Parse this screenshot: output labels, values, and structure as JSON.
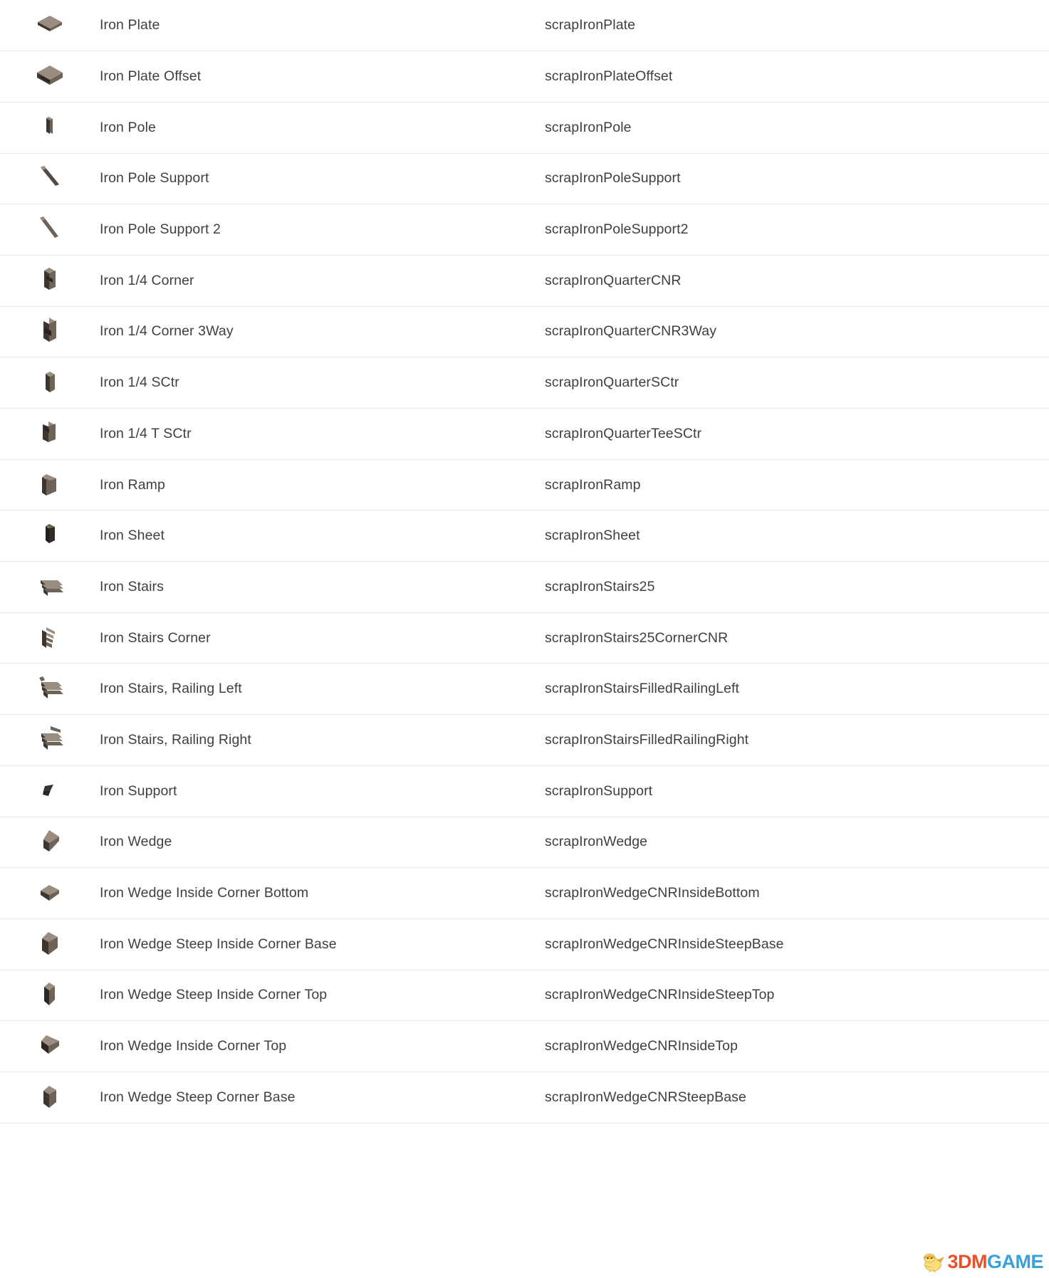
{
  "table": {
    "columns": [
      "icon",
      "display_name",
      "internal_id"
    ],
    "rows": [
      {
        "icon": "iron-plate-icon",
        "name": "Iron Plate",
        "id": "scrapIronPlate",
        "shape": "plate"
      },
      {
        "icon": "iron-plate-offset-icon",
        "name": "Iron Plate Offset",
        "id": "scrapIronPlateOffset",
        "shape": "plate-offset"
      },
      {
        "icon": "iron-pole-icon",
        "name": "Iron Pole",
        "id": "scrapIronPole",
        "shape": "pole"
      },
      {
        "icon": "iron-pole-support-icon",
        "name": "Iron Pole Support",
        "id": "scrapIronPoleSupport",
        "shape": "diag"
      },
      {
        "icon": "iron-pole-support-2-icon",
        "name": "Iron Pole Support 2",
        "id": "scrapIronPoleSupport2",
        "shape": "diag2"
      },
      {
        "icon": "iron-quarter-corner-icon",
        "name": "Iron 1/4 Corner",
        "id": "scrapIronQuarterCNR",
        "shape": "qcorner"
      },
      {
        "icon": "iron-quarter-corner-3way-icon",
        "name": "Iron 1/4 Corner 3Way",
        "id": "scrapIronQuarterCNR3Way",
        "shape": "qcorner3"
      },
      {
        "icon": "iron-quarter-sctr-icon",
        "name": "Iron 1/4 SCtr",
        "id": "scrapIronQuarterSCtr",
        "shape": "qsctr"
      },
      {
        "icon": "iron-quarter-tee-sctr-icon",
        "name": "Iron 1/4 T SCtr",
        "id": "scrapIronQuarterTeeSCtr",
        "shape": "qtee"
      },
      {
        "icon": "iron-ramp-icon",
        "name": "Iron Ramp",
        "id": "scrapIronRamp",
        "shape": "ramp"
      },
      {
        "icon": "iron-sheet-icon",
        "name": "Iron Sheet",
        "id": "scrapIronSheet",
        "shape": "sheet"
      },
      {
        "icon": "iron-stairs-icon",
        "name": "Iron Stairs",
        "id": "scrapIronStairs25",
        "shape": "stairs"
      },
      {
        "icon": "iron-stairs-corner-icon",
        "name": "Iron Stairs Corner",
        "id": "scrapIronStairs25CornerCNR",
        "shape": "stairs-corner"
      },
      {
        "icon": "iron-stairs-railing-left-icon",
        "name": "Iron Stairs, Railing Left",
        "id": "scrapIronStairsFilledRailingLeft",
        "shape": "stairs-rail-l"
      },
      {
        "icon": "iron-stairs-railing-right-icon",
        "name": "Iron Stairs, Railing Right",
        "id": "scrapIronStairsFilledRailingRight",
        "shape": "stairs-rail-r"
      },
      {
        "icon": "iron-support-icon",
        "name": "Iron Support",
        "id": "scrapIronSupport",
        "shape": "support"
      },
      {
        "icon": "iron-wedge-icon",
        "name": "Iron Wedge",
        "id": "scrapIronWedge",
        "shape": "wedge"
      },
      {
        "icon": "iron-wedge-inside-corner-bottom-icon",
        "name": "Iron Wedge Inside Corner Bottom",
        "id": "scrapIronWedgeCNRInsideBottom",
        "shape": "wedge-flat"
      },
      {
        "icon": "iron-wedge-steep-inside-corner-base-icon",
        "name": "Iron Wedge Steep Inside Corner Base",
        "id": "scrapIronWedgeCNRInsideSteepBase",
        "shape": "wedge-steep"
      },
      {
        "icon": "iron-wedge-steep-inside-corner-top-icon",
        "name": "Iron Wedge Steep Inside Corner Top",
        "id": "scrapIronWedgeCNRInsideSteepTop",
        "shape": "wedge-steep-top"
      },
      {
        "icon": "iron-wedge-inside-corner-top-icon",
        "name": "Iron Wedge Inside Corner Top",
        "id": "scrapIronWedgeCNRInsideTop",
        "shape": "wedge-inside-top"
      },
      {
        "icon": "iron-wedge-steep-corner-base-icon",
        "name": "Iron Wedge Steep Corner Base",
        "id": "scrapIronWedgeCNRSteepBase",
        "shape": "wedge-steep-base"
      }
    ]
  },
  "watermark": {
    "part1": "3DM",
    "part2": "GAME",
    "bird": "chick-mascot-icon"
  },
  "colors": {
    "row_divider": "#ececec",
    "text": "#3f3f3f",
    "background": "#ffffff",
    "icon_light": "#9a8d80",
    "icon_mid": "#6f6257",
    "icon_dark": "#3d352e",
    "wm_red": "#e8502a",
    "wm_orange": "#f0942e",
    "wm_blue": "#3aa0d8",
    "wm_yellow": "#f5cf52"
  }
}
